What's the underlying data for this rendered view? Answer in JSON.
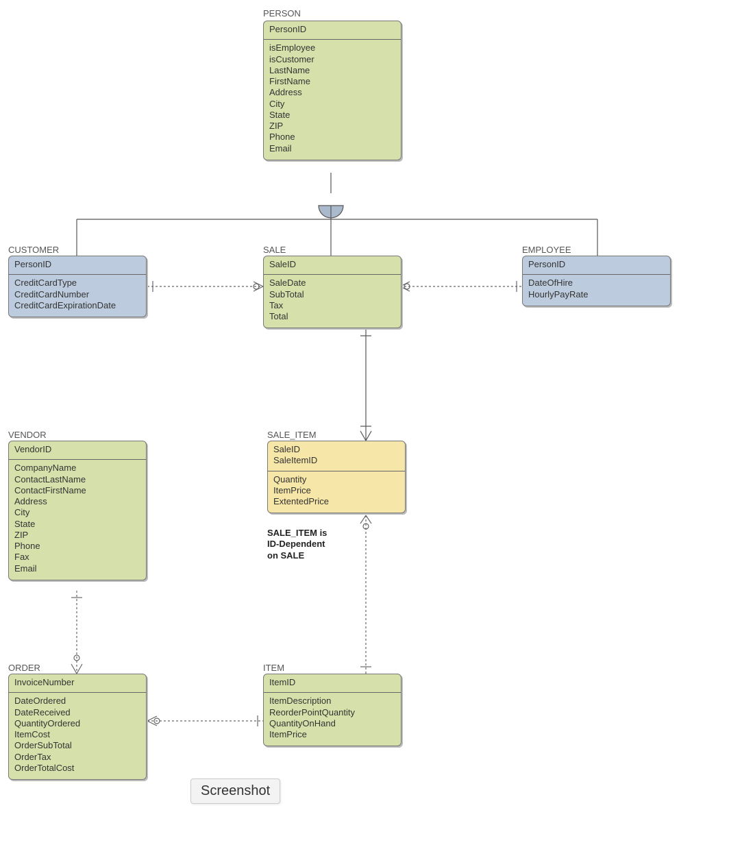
{
  "entities": {
    "person": {
      "label": "PERSON",
      "keys": [
        "PersonID"
      ],
      "attrs": [
        "isEmployee",
        "isCustomer",
        "LastName",
        "FirstName",
        "Address",
        "City",
        "State",
        "ZIP",
        "Phone",
        "Email"
      ]
    },
    "customer": {
      "label": "CUSTOMER",
      "keys": [
        "PersonID"
      ],
      "attrs": [
        "CreditCardType",
        "CreditCardNumber",
        "CreditCardExpirationDate"
      ]
    },
    "sale": {
      "label": "SALE",
      "keys": [
        "SaleID"
      ],
      "attrs": [
        "SaleDate",
        "SubTotal",
        "Tax",
        "Total"
      ]
    },
    "employee": {
      "label": "EMPLOYEE",
      "keys": [
        "PersonID"
      ],
      "attrs": [
        "DateOfHire",
        "HourlyPayRate"
      ]
    },
    "vendor": {
      "label": "VENDOR",
      "keys": [
        "VendorID"
      ],
      "attrs": [
        "CompanyName",
        "ContactLastName",
        "ContactFirstName",
        "Address",
        "City",
        "State",
        "ZIP",
        "Phone",
        "Fax",
        "Email"
      ]
    },
    "sale_item": {
      "label": "SALE_ITEM",
      "keys": [
        "SaleID",
        "SaleItemID"
      ],
      "attrs": [
        "Quantity",
        "ItemPrice",
        "ExtentedPrice"
      ]
    },
    "order": {
      "label": "ORDER",
      "keys": [
        "InvoiceNumber"
      ],
      "attrs": [
        "DateOrdered",
        "DateReceived",
        "QuantityOrdered",
        "ItemCost",
        "OrderSubTotal",
        "OrderTax",
        "OrderTotalCost"
      ]
    },
    "item": {
      "label": "ITEM",
      "keys": [
        "ItemID"
      ],
      "attrs": [
        "ItemDescription",
        "ReorderPointQuantity",
        "QuantityOnHand",
        "ItemPrice"
      ]
    }
  },
  "note": {
    "line1": "SALE_ITEM is",
    "line2": "ID-Dependent",
    "line3": "on SALE"
  },
  "tooltip": "Screenshot",
  "colors": {
    "solid_line": "#555",
    "dashed_line": "#666"
  }
}
